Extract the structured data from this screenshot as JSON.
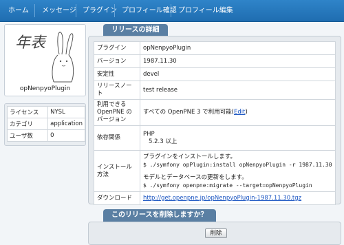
{
  "nav": {
    "items": [
      "ホーム",
      "メッセージ",
      "プラグイン",
      "プロフィール確認",
      "プロフィール編集"
    ]
  },
  "profile": {
    "name": "opNenpyoPlugin",
    "avatar_text": "年表"
  },
  "plugin_info": {
    "rows": [
      {
        "label": "ライセンス",
        "value": "NYSL"
      },
      {
        "label": "カテゴリ",
        "value": "application"
      },
      {
        "label": "ユーザ数",
        "value": "0"
      }
    ]
  },
  "release": {
    "section_title": "リリースの詳細",
    "rows": {
      "plugin": {
        "label": "プラグイン",
        "value": "opNenpyoPlugin"
      },
      "version": {
        "label": "バージョン",
        "value": "1987.11.30"
      },
      "stability": {
        "label": "安定性",
        "value": "devel"
      },
      "note": {
        "label": "リリースノート",
        "value": "test release"
      },
      "compat": {
        "label": "利用できる OpenPNE のバージョン",
        "value": "すべての OpenPNE 3 で利用可能",
        "edit": "Edit"
      },
      "deps": {
        "label": "依存関係",
        "line1": "PHP",
        "line2": "5.2.3 以上"
      },
      "install": {
        "label": "インストール方法",
        "line1": "プラグインをインストールします。",
        "line2": "$ ./symfony opPlugin:install opNenpyoPlugin -r 1987.11.30",
        "line3": "モデルとデータベースの更新をします。",
        "line4": "$ ./symfony openpne:migrate --target=opNenpyoPlugin"
      },
      "download": {
        "label": "ダウンロード",
        "url": "http://get.openpne.jp/opNenpyoPlugin-1987.11.30.tgz"
      }
    }
  },
  "delete": {
    "section_title": "このリリースを削除しますか？",
    "button_label": "削除"
  }
}
